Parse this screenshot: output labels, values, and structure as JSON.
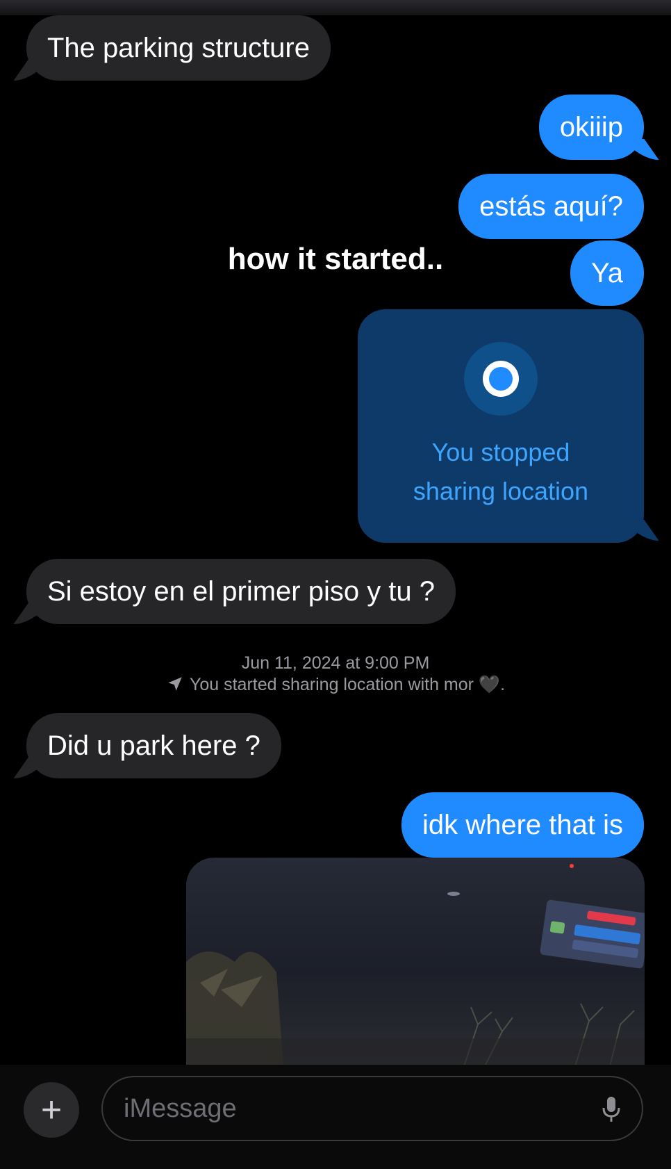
{
  "messages": [
    {
      "id": "m1",
      "text": "The parking structure"
    },
    {
      "id": "m2",
      "text": "okiiip"
    },
    {
      "id": "m3",
      "text": "estás aquí?"
    },
    {
      "id": "m4",
      "text": "Ya"
    },
    {
      "id": "m5",
      "text": "Si estoy en el primer piso y tu ?"
    },
    {
      "id": "m6",
      "text": "Did u park here ?"
    },
    {
      "id": "m7",
      "text": "idk where that is"
    }
  ],
  "location_card": {
    "line1": "You stopped",
    "line2": "sharing location"
  },
  "system_note": {
    "timestamp": "Jun 11, 2024 at 9:00 PM",
    "text": "You started sharing location with mor 🖤."
  },
  "overlay_caption": "how it started..",
  "composer": {
    "placeholder": "iMessage"
  },
  "icons": {
    "plus": "plus-icon",
    "mic": "microphone-icon",
    "location_arrow": "location-arrow-icon",
    "location_pin": "location-dot-icon"
  },
  "colors": {
    "sent_bubble": "#1f8bff",
    "received_bubble": "#262629",
    "location_card": "#0d3a68",
    "location_text": "#3ea5ff"
  }
}
